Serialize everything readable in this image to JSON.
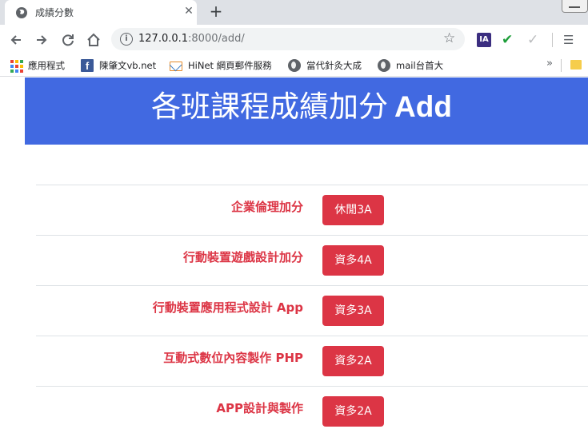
{
  "browser": {
    "tab_title": "成績分數",
    "tab_close": "✕",
    "new_tab": "+",
    "url_host": "127.0.0.1",
    "url_rest": ":8000/add/",
    "extension_ia": "IA"
  },
  "bookmarks": [
    {
      "label": "應用程式",
      "icon": "apps-grid-icon"
    },
    {
      "label": "陳肇文vb.net",
      "icon": "facebook-icon"
    },
    {
      "label": "HiNet 網頁郵件服務",
      "icon": "mail-icon"
    },
    {
      "label": "當代針灸大成",
      "icon": "globe-icon"
    },
    {
      "label": "mail台首大",
      "icon": "globe-icon"
    }
  ],
  "bookmarks_more": "»",
  "page": {
    "title_cn": "各班課程成績加分",
    "title_en": "Add",
    "courses": [
      {
        "name": "企業倫理加分",
        "class": "休閒3A"
      },
      {
        "name": "行動裝置遊戲設計加分",
        "class": "資多4A"
      },
      {
        "name": "行動裝置應用程式設計 App",
        "class": "資多3A"
      },
      {
        "name": "互動式數位內容製作 PHP",
        "class": "資多2A"
      },
      {
        "name": "APP設計與製作",
        "class": "資多2A"
      }
    ]
  },
  "colors": {
    "banner": "#4169e1",
    "accent_red": "#dc3545"
  }
}
